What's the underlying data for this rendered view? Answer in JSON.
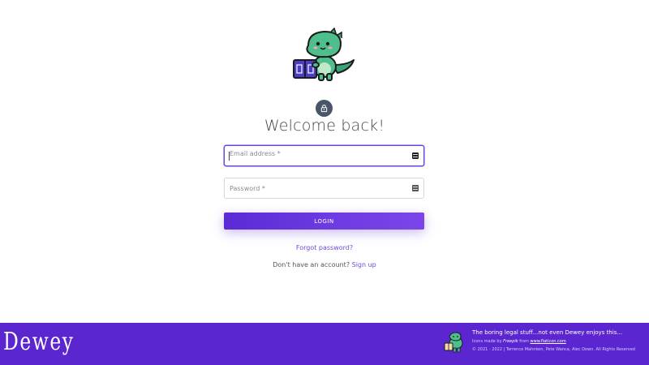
{
  "login": {
    "title": "Welcome back!",
    "email_placeholder": "Email address *",
    "password_placeholder": "Password *",
    "login_label": "LOGIN",
    "forgot_password": "Forgot password?",
    "no_account_text": "Don't have an account?",
    "signup_link": "Sign up"
  },
  "icons": {
    "mascot": "dinosaur-reading-book-icon",
    "lock": "lock-icon",
    "field_action": "keyboard-icon"
  },
  "footer": {
    "brand": "Dewey",
    "tagline": "The boring legal stuff...not even Dewey enjoys this...",
    "credit_prefix": "Icons made by",
    "credit_author": "Freepik",
    "credit_from": "from",
    "credit_site": "www.flaticon.com",
    "copyright": "© 2021 - 2022 | Terrence Mahnken, Pete Wanca, Alec Down. All Rights Reserved"
  },
  "colors": {
    "accent": "#6d44d9",
    "footer_bg": "#5b26cf",
    "button_start": "#5a2ad6",
    "button_end": "#7b45ea",
    "lock_badge": "#4a5568"
  }
}
